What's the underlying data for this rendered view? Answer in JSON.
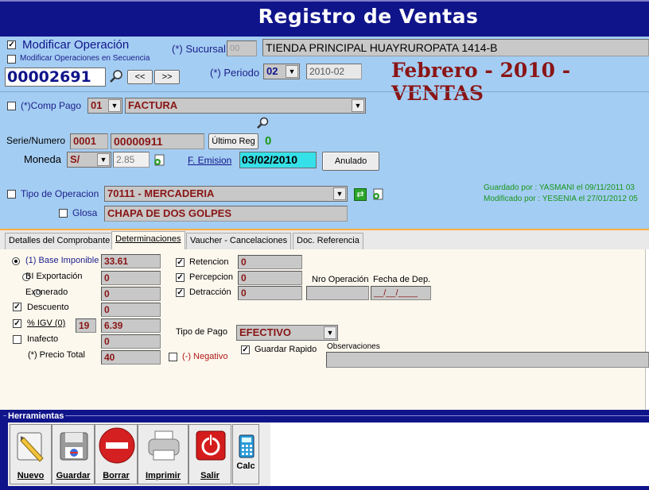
{
  "window": {
    "title": "Registro de Ventas"
  },
  "operation": {
    "modificar_label": "Modificar Operación",
    "modificar_checked": true,
    "secuencia_label": "Modificar Operaciones en Secuencia",
    "number": "00002691",
    "prev_label": "<<",
    "next_label": ">>"
  },
  "sucursal": {
    "label": "(*) Sucursal",
    "code": "00",
    "name": "TIENDA PRINCIPAL HUAYRUROPATA 1414-B"
  },
  "periodo": {
    "label": "(*) Periodo",
    "month": "02",
    "value": "2010-02",
    "banner": "Febrero - 2010 - VENTAS"
  },
  "comprobante": {
    "label": "(*)Comp Pago",
    "code": "01",
    "name": "FACTURA",
    "serie_label": "Serie/Numero",
    "serie": "0001",
    "numero": "00000911",
    "ultimo_label": "Último Reg",
    "ultimo_value": "0",
    "moneda_label": "Moneda",
    "moneda": "S/",
    "tipo_cambio": "2.85",
    "emision_label": "F. Emision",
    "emision_value": "03/02/2010",
    "anulado_label": "Anulado"
  },
  "operacion": {
    "tipo_label": "Tipo de Operacion",
    "tipo_value": "70111 - MERCADERIA",
    "glosa_label": "Glosa",
    "glosa_value": "CHAPA DE DOS GOLPES",
    "guardado": "Guardado por : YASMANI el 09/11/2011 03",
    "modificado": "Modificado por : YESENIA el 27/01/2012 05"
  },
  "tabs": [
    {
      "label": "Detalles del Comprobante"
    },
    {
      "label": "Determinaciones"
    },
    {
      "label": "Vaucher - Cancelaciones"
    },
    {
      "label": "Doc. Referencia"
    }
  ],
  "determinaciones": {
    "base_label": "(1) Base Imponible",
    "base_value": "33.61",
    "bi_exp_label": "BI Exportación",
    "bi_exp_value": "0",
    "exonerado_label": "Exonerado",
    "exonerado_value": "0",
    "descuento_label": "Descuento",
    "descuento_value": "0",
    "igv_label": "% IGV (0)",
    "igv_rate": "19",
    "igv_value": "6.39",
    "inafecto_label": "Inafecto",
    "inafecto_value": "0",
    "precio_label": "(*) Precio Total",
    "precio_value": "40",
    "negativo_label": "(-) Negativo",
    "retencion_label": "Retencion",
    "retencion_value": "0",
    "percepcion_label": "Percepcion",
    "percepcion_value": "0",
    "detraccion_label": "Detracción",
    "detraccion_value": "0",
    "nro_operacion_label": "Nro Operación",
    "fecha_dep_label": "Fecha de Dep.",
    "fecha_dep_value": "__/__/____",
    "tipo_pago_label": "Tipo de Pago",
    "tipo_pago_value": "EFECTIVO",
    "guardar_rapido_label": "Guardar Rapido",
    "observaciones_label": "Observaciones"
  },
  "herramientas": {
    "label": "Herramientas",
    "nuevo": "Nuevo",
    "guardar": "Guardar",
    "borrar": "Borrar",
    "imprimir": "Imprimir",
    "salir": "Salir",
    "calc": "Calc"
  },
  "colors": {
    "title_bg": "#10148a",
    "form_bg": "#a4cdf3",
    "accent_red": "#8a1515",
    "panel_bg": "#fdf8ee"
  }
}
